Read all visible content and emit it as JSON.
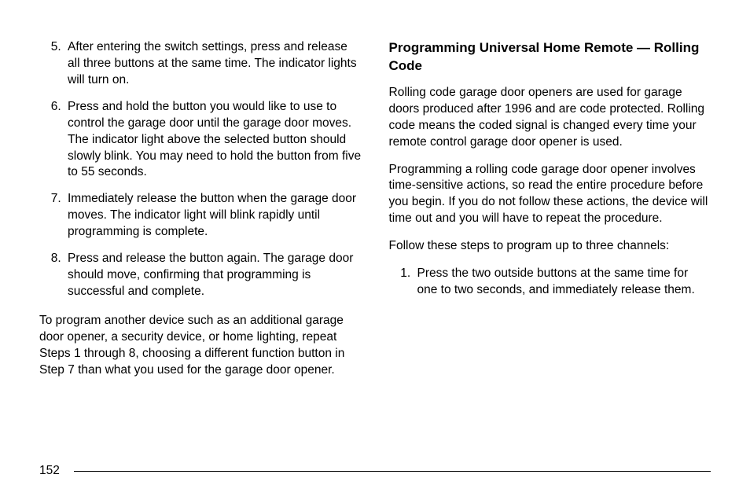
{
  "leftColumn": {
    "listItems": [
      "After entering the switch settings, press and release all three buttons at the same time. The indicator lights will turn on.",
      "Press and hold the button you would like to use to control the garage door until the garage door moves. The indicator light above the selected button should slowly blink. You may need to hold the button from five to 55 seconds.",
      "Immediately release the button when the garage door moves. The indicator light will blink rapidly until programming is complete.",
      "Press and release the button again. The garage door should move, confirming that programming is successful and complete."
    ],
    "paragraph": "To program another device such as an additional garage door opener, a security device, or home lighting, repeat Steps 1 through 8, choosing a different function button in Step 7 than what you used for the garage door opener."
  },
  "rightColumn": {
    "heading": "Programming Universal Home Remote — Rolling Code",
    "paragraph1": "Rolling code garage door openers are used for garage doors produced after 1996 and are code protected. Rolling code means the coded signal is changed every time your remote control garage door opener is used.",
    "paragraph2": "Programming a rolling code garage door opener involves time-sensitive actions, so read the entire procedure before you begin. If you do not follow these actions, the device will time out and you will have to repeat the procedure.",
    "paragraph3": "Follow these steps to program up to three channels:",
    "listItems": [
      "Press the two outside buttons at the same time for one to two seconds, and immediately release them."
    ]
  },
  "pageNumber": "152"
}
